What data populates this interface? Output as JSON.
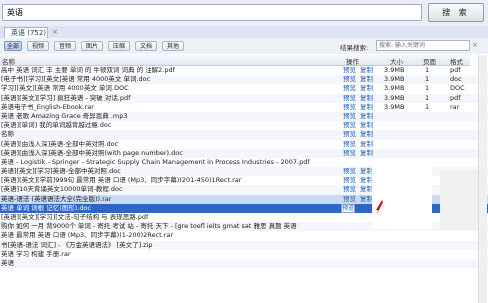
{
  "search": {
    "value": "英语",
    "button": "搜 索"
  },
  "tab": {
    "label": "英语 (752)",
    "close": "×"
  },
  "filters": {
    "buttons": [
      "全部",
      "视频",
      "音频",
      "图片",
      "压缩",
      "文档",
      "其他"
    ],
    "result_label": "结果搜索:",
    "result_placeholder": "搜索: 输入关键词",
    "clear": "×"
  },
  "columns": {
    "name": "名称",
    "actions": "操作",
    "size": "大小",
    "pages": "页面",
    "format": "格式"
  },
  "row_actions": {
    "preview": "预览",
    "copy": "复制"
  },
  "rows": [
    {
      "name": "高中 英语 词汇 丰 主要 单词 的 牛顿双词 词典 的 注解2.pdf",
      "size": "3.9MB",
      "pages": "1",
      "fmt": "pdf"
    },
    {
      "name": "[电子书][学习][英文]英语 常用 4000英文 单词.doc",
      "size": "3.9MB",
      "pages": "1",
      "fmt": "doc"
    },
    {
      "name": "学习][英文][英语 常用 4000英文 单词.DOC",
      "size": "3.9MB",
      "pages": "1",
      "fmt": "DOC"
    },
    {
      "name": "[英语][英文][学习] 疯狂英语 - 突破 对话.pdf",
      "size": "3.9MB",
      "pages": "1",
      "fmt": "pdf"
    },
    {
      "name": "英语电子书_English-Ebook.rar",
      "size": "3.9MB",
      "pages": "1",
      "fmt": "rar"
    },
    {
      "name": "英语 老歌 Amazing Grace 奇异恩典 .mp3",
      "size": "",
      "pages": "",
      "fmt": ""
    },
    {
      "name": "[英语][单词] 我的单词越背越过瘾.doc",
      "size": "",
      "pages": "",
      "fmt": ""
    },
    {
      "name": "名称",
      "size": "",
      "pages": "",
      "fmt": ""
    },
    {
      "name": "[英语][由浅入深]英语-全部中英对照.doc",
      "size": "",
      "pages": "",
      "fmt": ""
    },
    {
      "name": "[英语][由浅入深]英语-全部中英对照(with page number).doc",
      "size": "",
      "pages": "",
      "fmt": ""
    },
    {
      "name": "英语 - Logistik - Springer - Strategic Supply Chain Management in Process Industries - 2007.pdf",
      "size": "",
      "pages": "",
      "fmt": ""
    },
    {
      "name": "英语][英文][学习]英语-全部中英对照.doc",
      "size": "",
      "pages": "",
      "fmt": ""
    },
    {
      "name": "[英语][英文][学前]999句 最常用 英语 口语 (Mp3、同步字幕)(201-450)1Rect.rar",
      "size": "",
      "pages": "",
      "fmt": ""
    },
    {
      "name": "[英语]10天背诵英文10000单词-教程.doc",
      "size": "",
      "pages": "",
      "fmt": ""
    },
    {
      "name": "英语-语法 (英语语法大全(完全版)).rar",
      "size": "",
      "pages": "",
      "fmt": ""
    },
    {
      "name": "英语 单词 词根 记忆(图形).doc",
      "size": "",
      "pages": "",
      "fmt": ""
    },
    {
      "name": "[英语][英文][学习][文法-句子结构 与 表现思路.pdf",
      "size": "",
      "pages": "",
      "fmt": ""
    },
    {
      "name": "购你 如何 一月 背9000个 单词 - 寄托 考试 站 - 寄托 天下 - [gre toefl ielts gmat sat 雅思 真题 英语",
      "size": "",
      "pages": "",
      "fmt": ""
    },
    {
      "name": "英语 最常用 英语 口语 (Mp3、同步字幕)(1-200)2Rect.rar",
      "size": "",
      "pages": "",
      "fmt": ""
    },
    {
      "name": "书[英语-语法 词汇] - 《万金英语语法》 [英文了].zip",
      "size": "",
      "pages": "",
      "fmt": ""
    },
    {
      "name": "英语 学习 构建 手册.rar",
      "size": "",
      "pages": "",
      "fmt": ""
    },
    {
      "name": "英语",
      "size": "",
      "pages": "",
      "fmt": ""
    }
  ]
}
